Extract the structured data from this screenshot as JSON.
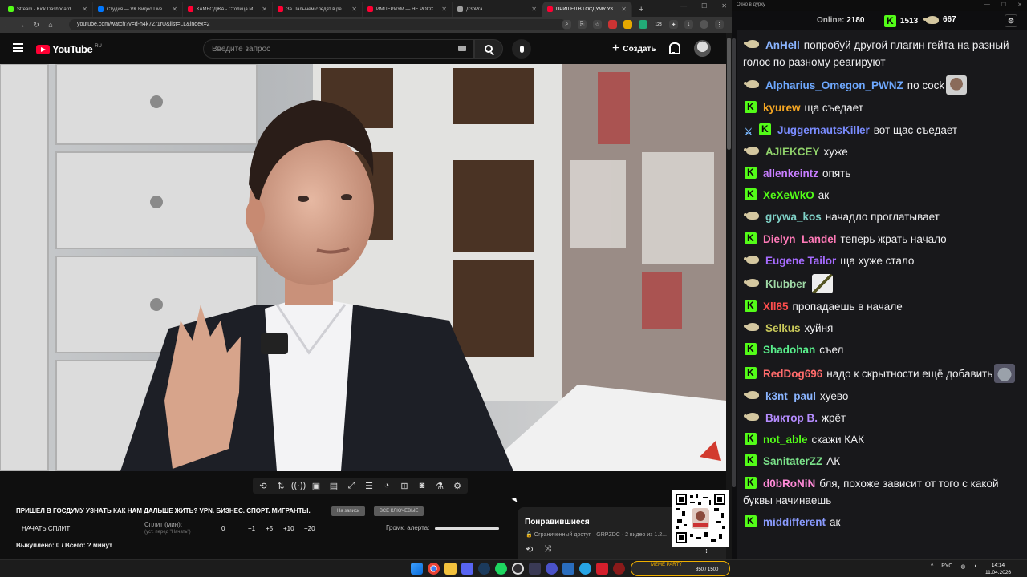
{
  "tabs": [
    {
      "label": "Stream - Kick Dashboard",
      "color": "#53fc18",
      "active": false
    },
    {
      "label": "Студия — VK Видео Live",
      "color": "#0077ff",
      "active": false
    },
    {
      "label": "КАМБОДЖА - Столица Ми...",
      "color": "#ff0033",
      "active": false
    },
    {
      "label": "За Палычем следят в реал...",
      "color": "#ff0033",
      "active": false
    },
    {
      "label": "ИМПЕРИУМ — НЕ РОССИЯ...",
      "color": "#ff0033",
      "active": false
    },
    {
      "label": "ДЗоРга",
      "color": "#a0a0a0",
      "active": false
    },
    {
      "label": "ПРИШЕЛ В ГОСДУМУ УЗНАТ...",
      "color": "#ff0033",
      "active": true
    }
  ],
  "browser": {
    "url": "youtube.com/watch?v=d-h4k7Zr1rU&list=LL&index=2",
    "ext_badge": "123"
  },
  "youtube": {
    "logo": "YouTube",
    "region": "RU",
    "search_placeholder": "Введите запрос",
    "create_label": "Создать"
  },
  "panel": {
    "title": "ПРИШЕЛ В ГОСДУМУ УЗНАТЬ КАК НАМ ДАЛЬШЕ ЖИТЬ? VPN. БИЗНЕС. СПОРТ. МИГРАНТЫ.",
    "btn1": "На запись",
    "btn2": "ВСЕ КЛЮЧЕВЫЕ",
    "split_button": "НАЧАТЬ СПЛИТ",
    "split_label": "Сплит (мин):",
    "split_sub": "(уст. перед \"Начать\")",
    "split_value": "0",
    "inc1": "+1",
    "inc5": "+5",
    "inc10": "+10",
    "inc20": "+20",
    "volume_label": "Громк. алерта:",
    "volume": 1.0,
    "bought": "Выкуплено: 0 / Всего: ? минут"
  },
  "liked": {
    "title": "Понравившиеся",
    "access": "Ограниченный доступ",
    "meta": "GRPZDC · 2 видео из 1.2..."
  },
  "chat": {
    "window_title": "Окно в дурку",
    "online_label": "Online:",
    "online_value": "2180",
    "kick_count": "1513",
    "yt_count": "667",
    "messages": [
      {
        "src": "yt",
        "user": "AnHell",
        "color": "#8ab4ff",
        "text": "попробуй другой плагин гейта на разный голос по разному реагируют",
        "emote": ""
      },
      {
        "src": "yt",
        "user": "Alpharius_Omegon_PWNZ",
        "color": "#6ea8fe",
        "text": "по cock",
        "emote": "face"
      },
      {
        "src": "kick",
        "user": "kyurew",
        "color": "#f5a623",
        "text": "ща съедает",
        "emote": ""
      },
      {
        "src": "kick-sword",
        "user": "JuggernautsKiller",
        "color": "#7a8cff",
        "text": "вот щас съедает",
        "emote": ""
      },
      {
        "src": "yt",
        "user": "AJIEKCEY",
        "color": "#8fd16a",
        "text": "хуже",
        "emote": ""
      },
      {
        "src": "kick",
        "user": "allenkeintz",
        "color": "#c77dff",
        "text": "опять",
        "emote": ""
      },
      {
        "src": "kick",
        "user": "XeXeWkO",
        "color": "#53fc18",
        "text": "ак",
        "emote": ""
      },
      {
        "src": "yt",
        "user": "grywa_kos",
        "color": "#7fd1c7",
        "text": "начадло проглатывает",
        "emote": ""
      },
      {
        "src": "kick",
        "user": "Dielyn_Landel",
        "color": "#ff7ab8",
        "text": "теперь жрать начало",
        "emote": ""
      },
      {
        "src": "yt",
        "user": "Eugene Tailor",
        "color": "#a66bff",
        "text": "ща хуже стало",
        "emote": ""
      },
      {
        "src": "yt",
        "user": "Klubber",
        "color": "#9fd9a6",
        "text": "",
        "emote": "knife"
      },
      {
        "src": "kick",
        "user": "Xll85",
        "color": "#ff4d4d",
        "text": "пропадаешь в начале",
        "emote": ""
      },
      {
        "src": "yt",
        "user": "Selkus",
        "color": "#c9c95a",
        "text": "хуйня",
        "emote": ""
      },
      {
        "src": "kick",
        "user": "Shadohan",
        "color": "#59f08c",
        "text": "съел",
        "emote": ""
      },
      {
        "src": "kick",
        "user": "RedDog696",
        "color": "#ff6b6b",
        "text": "надо к скрытности ещё добавить",
        "emote": "wolf"
      },
      {
        "src": "yt",
        "user": "k3nt_paul",
        "color": "#8ab4ff",
        "text": "хуево",
        "emote": ""
      },
      {
        "src": "yt",
        "user": "Виктор В.",
        "color": "#b58cff",
        "text": "жрёт",
        "emote": ""
      },
      {
        "src": "kick",
        "user": "not_able",
        "color": "#53fc18",
        "text": "скажи КАК",
        "emote": ""
      },
      {
        "src": "kick",
        "user": "SanitaterZZ",
        "color": "#7be38a",
        "text": "АК",
        "emote": ""
      },
      {
        "src": "kick",
        "user": "d0bRoNiN",
        "color": "#ff8ad8",
        "text": "бля, похоже зависит от того с какой буквы начинаешь",
        "emote": ""
      },
      {
        "src": "kick",
        "user": "middifferent",
        "color": "#8a9bff",
        "text": "ак",
        "emote": ""
      }
    ]
  },
  "taskbar": {
    "party_label": "MEME PARTY",
    "party_value": "850 / 1500",
    "lang": "РУС",
    "time": "14:14",
    "date": "11.04.2026"
  }
}
